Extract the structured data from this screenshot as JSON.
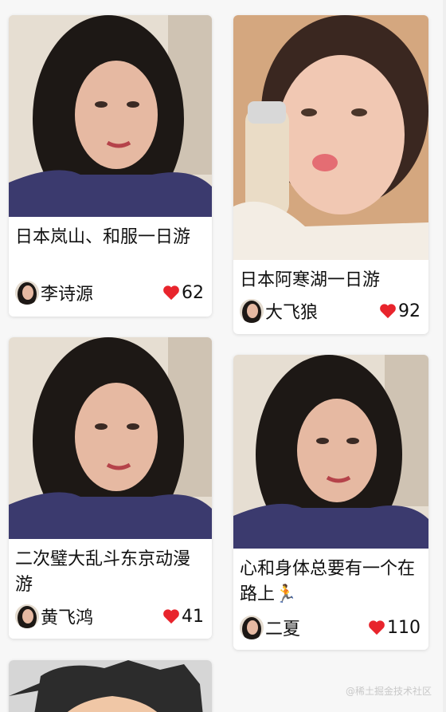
{
  "feed": {
    "cards": [
      {
        "title": "日本岚山、和服一日游",
        "author": "李诗源",
        "likes": "62",
        "photo": "woman-long-hair"
      },
      {
        "title": "日本阿寒湖一日游",
        "author": "大飞狼",
        "likes": "92",
        "photo": "woman-foundation-bottle"
      },
      {
        "title": "二次璧大乱斗东京动漫游",
        "author": "黄飞鸿",
        "likes": "41",
        "photo": "woman-long-hair"
      },
      {
        "title": "心和身体总要有一个在路上🏃",
        "author": "二夏",
        "likes": "110",
        "photo": "woman-long-hair"
      },
      {
        "title": "",
        "author": "",
        "likes": "",
        "photo": "anime-man"
      }
    ]
  },
  "watermark": "@稀土掘金技术社区",
  "colors": {
    "heart": "#e8242c",
    "background": "#f7f7f7"
  }
}
